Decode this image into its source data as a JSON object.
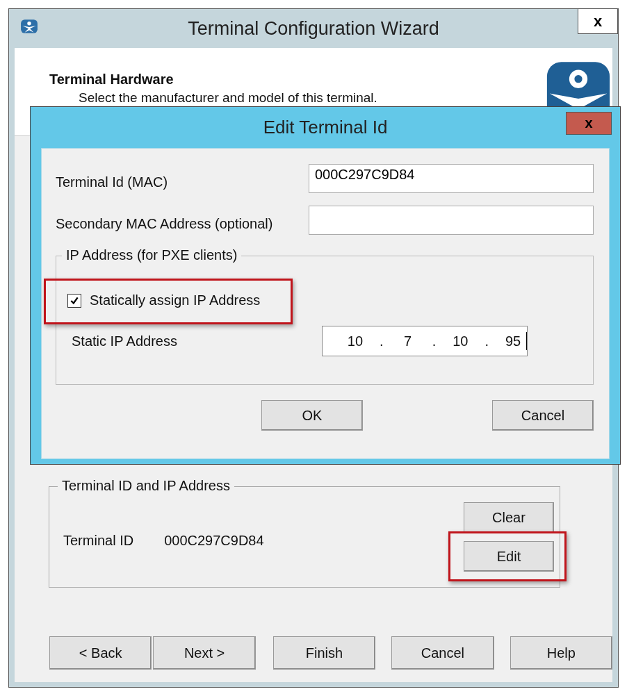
{
  "window": {
    "title": "Terminal Configuration Wizard",
    "close": "x"
  },
  "header": {
    "title": "Terminal Hardware",
    "subtitle": "Select the manufacturer and model of this terminal."
  },
  "terminal_group": {
    "legend": "Terminal ID and IP Address",
    "label": "Terminal ID",
    "value": "000C297C9D84",
    "buttons": [
      {
        "label": "Clear",
        "highlighted": false
      },
      {
        "label": "Edit",
        "highlighted": true
      }
    ]
  },
  "nav_buttons": [
    {
      "label": "< Back"
    },
    {
      "label": "Next >"
    },
    {
      "label": "Finish"
    },
    {
      "label": "Cancel"
    },
    {
      "label": "Help"
    }
  ],
  "dialog": {
    "title": "Edit Terminal Id",
    "close": "x",
    "fields": [
      {
        "label": "Terminal Id (MAC)",
        "value": "000C297C9D84"
      },
      {
        "label": "Secondary MAC Address (optional)"
      }
    ],
    "ip_group": {
      "legend": "IP Address (for PXE clients)",
      "checkbox": {
        "label": "Statically assign IP Address",
        "checked": true,
        "highlighted": true
      },
      "ip_label": "Static IP Address",
      "octets": [
        "10",
        "7",
        "10",
        "95"
      ],
      "separator": "."
    },
    "buttons": [
      {
        "label": "OK"
      },
      {
        "label": "Cancel"
      }
    ]
  }
}
